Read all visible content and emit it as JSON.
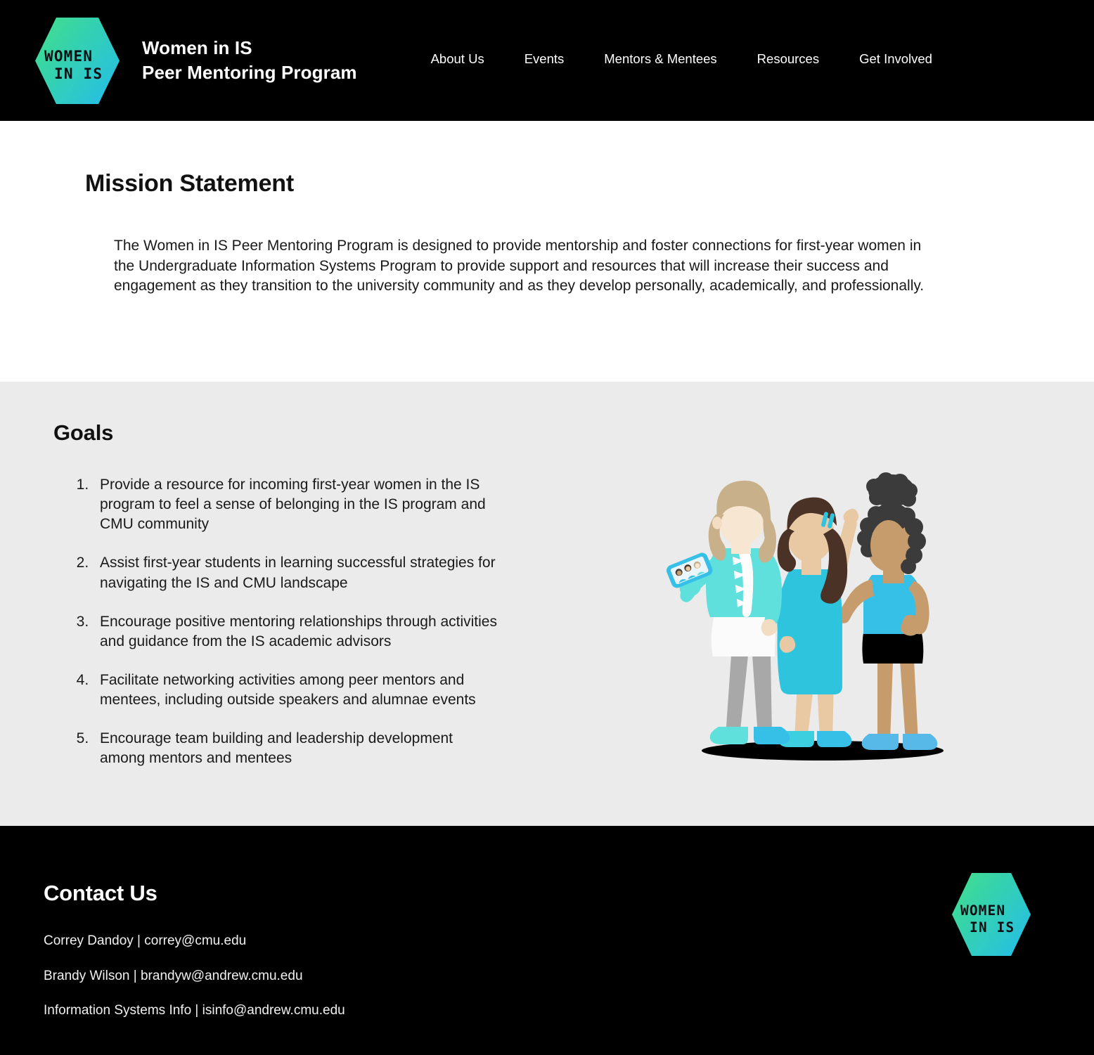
{
  "header": {
    "logo_alt": "WOMEN IN IS",
    "logo_line1": "WOMEN",
    "logo_line2": "IN IS",
    "brand_title": "Women in IS\nPeer Mentoring Program",
    "nav": [
      {
        "label": "About Us"
      },
      {
        "label": "Events"
      },
      {
        "label": "Mentors & Mentees"
      },
      {
        "label": "Resources"
      },
      {
        "label": "Get Involved"
      }
    ]
  },
  "mission": {
    "heading": "Mission Statement",
    "body": "The Women in IS Peer Mentoring Program is designed to provide mentorship and foster connections for first-year women in the Undergraduate Information Systems Program to provide support and resources that will increase their success and engagement as they transition to the university community and as they develop personally, academically, and professionally."
  },
  "goals": {
    "heading": "Goals",
    "items": [
      "Provide a resource for incoming first-year women in the IS program to feel a sense of belonging in the IS program and CMU community",
      "Assist first-year students in learning successful strategies for navigating the IS and CMU landscape",
      "Encourage positive mentoring relationships through activities and guidance from the IS academic advisors",
      "Facilitate networking activities among peer mentors and mentees, including outside speakers and alumnae events",
      "Encourage team building and leadership development among mentors and mentees"
    ],
    "illustration_alt": "three women taking a selfie"
  },
  "footer": {
    "heading": "Contact Us",
    "contacts": [
      "Correy Dandoy | correy@cmu.edu",
      "Brandy Wilson | brandyw@andrew.cmu.edu",
      "Information Systems Info | isinfo@andrew.cmu.edu"
    ],
    "logo_line1": "WOMEN",
    "logo_line2": "IN IS"
  },
  "colors": {
    "header_bg": "#000000",
    "page_bg": "#ffffff",
    "goals_bg": "#ebebeb",
    "footer_bg": "#000000",
    "text_dark": "#1a1a1a",
    "text_light": "#ffffff",
    "logo_green": "#3ddc84",
    "logo_cyan": "#29c6e8",
    "accent_turquoise": "#4fdbd8",
    "accent_blue": "#36c0e8",
    "accent_sky": "#56b9e8"
  }
}
